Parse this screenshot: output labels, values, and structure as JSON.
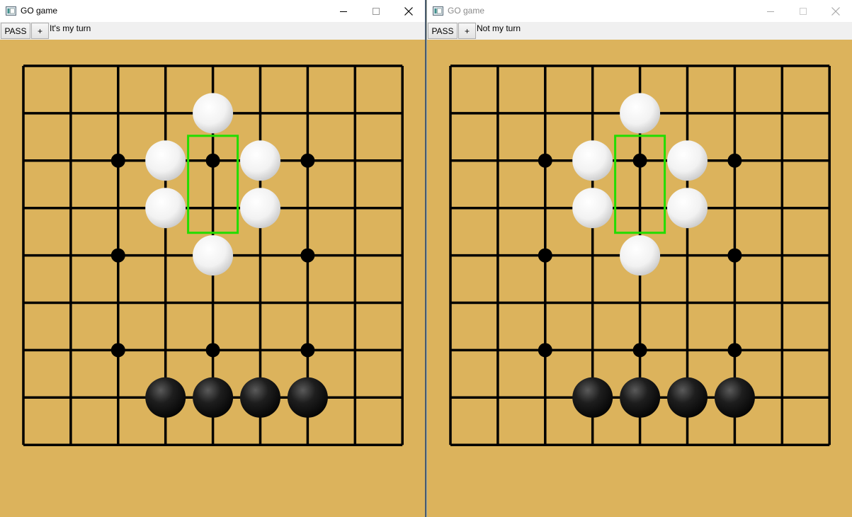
{
  "windows": [
    {
      "title": "GO game",
      "active": true,
      "toolbar": {
        "pass_label": "PASS",
        "add_label": "+",
        "status": "It's my turn"
      },
      "board": {
        "size": 9,
        "background": "#dcb35c",
        "star_points": [
          [
            2,
            2
          ],
          [
            2,
            4
          ],
          [
            2,
            6
          ],
          [
            4,
            2
          ],
          [
            4,
            6
          ],
          [
            6,
            2
          ],
          [
            6,
            4
          ],
          [
            6,
            6
          ]
        ],
        "white_stones": [
          [
            4,
            1
          ],
          [
            3,
            2
          ],
          [
            5,
            2
          ],
          [
            3,
            3
          ],
          [
            5,
            3
          ],
          [
            4,
            4
          ]
        ],
        "black_stones": [
          [
            3,
            7
          ],
          [
            4,
            7
          ],
          [
            5,
            7
          ],
          [
            6,
            7
          ]
        ],
        "highlight": {
          "color": "#22dd00",
          "col": 4,
          "rows": [
            2,
            3
          ]
        }
      }
    },
    {
      "title": "GO game",
      "active": false,
      "toolbar": {
        "pass_label": "PASS",
        "add_label": "+",
        "status": "Not my turn"
      },
      "board": {
        "size": 9,
        "background": "#dcb35c",
        "star_points": [
          [
            2,
            2
          ],
          [
            2,
            4
          ],
          [
            2,
            6
          ],
          [
            4,
            2
          ],
          [
            4,
            6
          ],
          [
            6,
            2
          ],
          [
            6,
            4
          ],
          [
            6,
            6
          ]
        ],
        "white_stones": [
          [
            4,
            1
          ],
          [
            3,
            2
          ],
          [
            5,
            2
          ],
          [
            3,
            3
          ],
          [
            5,
            3
          ],
          [
            4,
            4
          ]
        ],
        "black_stones": [
          [
            3,
            7
          ],
          [
            4,
            7
          ],
          [
            5,
            7
          ],
          [
            6,
            7
          ]
        ],
        "highlight": {
          "color": "#22dd00",
          "col": 4,
          "rows": [
            2,
            3
          ]
        }
      }
    }
  ]
}
